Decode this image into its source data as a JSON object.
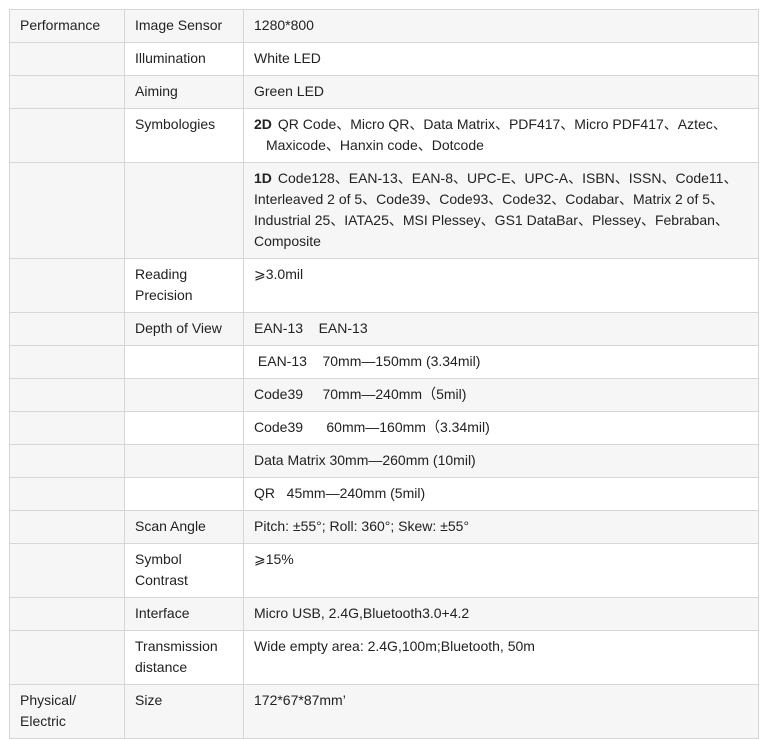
{
  "rows": [
    {
      "cat": "Performance",
      "key": "Image Sensor",
      "val": "1280*800"
    },
    {
      "cat": "",
      "key": "Illumination",
      "val": "White LED"
    },
    {
      "cat": "",
      "key": "Aiming",
      "val": "Green LED"
    },
    {
      "cat": "",
      "key": "Symbologies",
      "prefix": "2D",
      "val": "QR Code、Micro QR、Data Matrix、PDF417、Micro PDF417、Aztec、",
      "val2": "Maxicode、Hanxin code、Dotcode"
    },
    {
      "cat": "",
      "key": "",
      "prefix": "1D",
      "val": "Code128、EAN-13、EAN-8、UPC-E、UPC-A、ISBN、ISSN、Code11、Interleaved 2 of 5、Code39、Code93、Code32、Codabar、Matrix 2 of 5、Industrial 25、IATA25、MSI Plessey、GS1 DataBar、Plessey、Febraban、Composite"
    },
    {
      "cat": "",
      "key": "Reading Precision",
      "val": "⩾3.0mil"
    },
    {
      "cat": "",
      "key": "Depth of View",
      "val": "EAN-13    EAN-13"
    },
    {
      "cat": "",
      "key": "",
      "val": " EAN-13    70mm—150mm (3.34mil)"
    },
    {
      "cat": "",
      "key": "",
      "val": "Code39     70mm—240mm（5mil)"
    },
    {
      "cat": "",
      "key": "",
      "val": "Code39      60mm—160mm（3.34mil)"
    },
    {
      "cat": "",
      "key": "",
      "val": "Data Matrix 30mm—260mm (10mil)"
    },
    {
      "cat": "",
      "key": "",
      "val": "QR   45mm—240mm (5mil)"
    },
    {
      "cat": "",
      "key": "Scan Angle",
      "val": "Pitch: ±55°; Roll: 360°; Skew: ±55°"
    },
    {
      "cat": "",
      "key": "Symbol Contrast",
      "val": "⩾15%"
    },
    {
      "cat": "",
      "key": "Interface",
      "val": "Micro USB, 2.4G,Bluetooth3.0+4.2"
    },
    {
      "cat": "",
      "key": "Transmission distance",
      "val": "Wide empty area: 2.4G,100m;Bluetooth, 50m"
    },
    {
      "cat": "Physical/ Electric",
      "key": "Size",
      "val": "172*67*87mm’"
    }
  ]
}
